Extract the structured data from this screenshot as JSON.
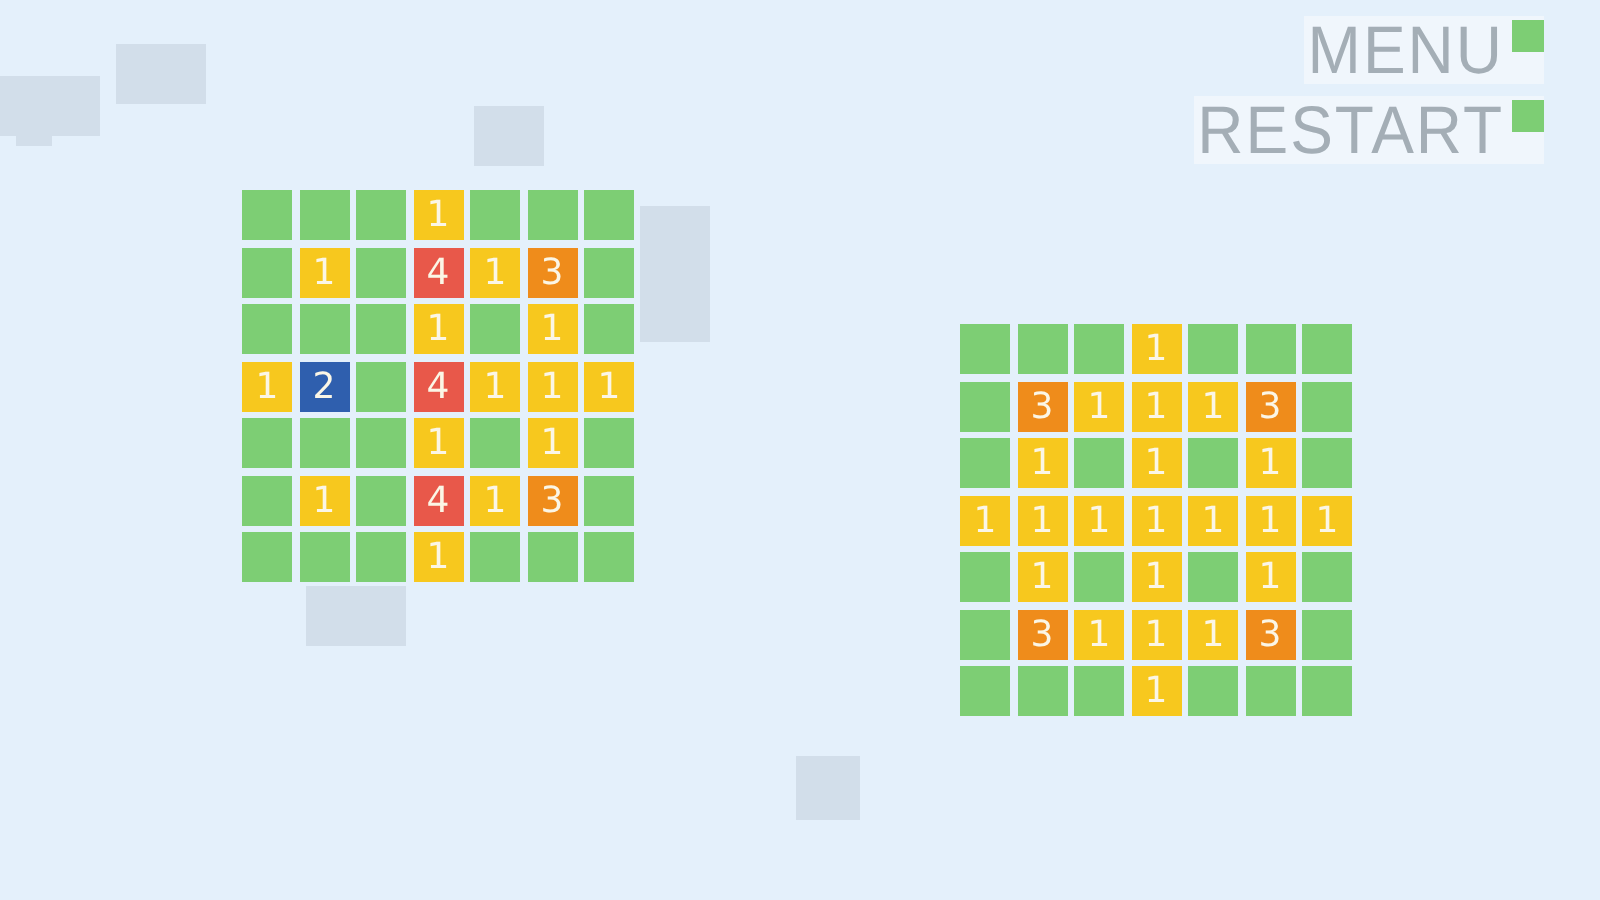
{
  "menu": [
    {
      "label": "MENU"
    },
    {
      "label": "RESTART"
    }
  ],
  "boards": [
    {
      "rows": [
        [
          {
            "color": "#7dce74"
          },
          {
            "color": "#7dce74"
          },
          {
            "color": "#7dce74"
          },
          {
            "n": "1",
            "color": "#f7c81e"
          },
          {
            "color": "#7dce74"
          },
          {
            "color": "#7dce74"
          },
          {
            "color": "#7dce74"
          }
        ],
        [
          {
            "color": "#7dce74"
          },
          {
            "n": "1",
            "color": "#f7c81e"
          },
          {
            "color": "#7dce74"
          },
          {
            "n": "4",
            "color": "#e8584a"
          },
          {
            "n": "1",
            "color": "#f7c81e"
          },
          {
            "n": "3",
            "color": "#ef8c1b"
          },
          {
            "color": "#7dce74"
          }
        ],
        [
          {
            "color": "#7dce74"
          },
          {
            "color": "#7dce74"
          },
          {
            "color": "#7dce74"
          },
          {
            "n": "1",
            "color": "#f7c81e"
          },
          {
            "color": "#7dce74"
          },
          {
            "n": "1",
            "color": "#f7c81e"
          },
          {
            "color": "#7dce74"
          }
        ],
        [
          {
            "n": "1",
            "color": "#f7c81e"
          },
          {
            "n": "2",
            "color": "#2f5fae"
          },
          {
            "color": "#7dce74"
          },
          {
            "n": "4",
            "color": "#e8584a"
          },
          {
            "n": "1",
            "color": "#f7c81e"
          },
          {
            "n": "1",
            "color": "#f7c81e"
          },
          {
            "n": "1",
            "color": "#f7c81e"
          }
        ],
        [
          {
            "color": "#7dce74"
          },
          {
            "color": "#7dce74"
          },
          {
            "color": "#7dce74"
          },
          {
            "n": "1",
            "color": "#f7c81e"
          },
          {
            "color": "#7dce74"
          },
          {
            "n": "1",
            "color": "#f7c81e"
          },
          {
            "color": "#7dce74"
          }
        ],
        [
          {
            "color": "#7dce74"
          },
          {
            "n": "1",
            "color": "#f7c81e"
          },
          {
            "color": "#7dce74"
          },
          {
            "n": "4",
            "color": "#e8584a"
          },
          {
            "n": "1",
            "color": "#f7c81e"
          },
          {
            "n": "3",
            "color": "#ef8c1b"
          },
          {
            "color": "#7dce74"
          }
        ],
        [
          {
            "color": "#7dce74"
          },
          {
            "color": "#7dce74"
          },
          {
            "color": "#7dce74"
          },
          {
            "n": "1",
            "color": "#f7c81e"
          },
          {
            "color": "#7dce74"
          },
          {
            "color": "#7dce74"
          },
          {
            "color": "#7dce74"
          }
        ]
      ]
    },
    {
      "rows": [
        [
          {
            "color": "#7dce74"
          },
          {
            "color": "#7dce74"
          },
          {
            "color": "#7dce74"
          },
          {
            "n": "1",
            "color": "#f7c81e"
          },
          {
            "color": "#7dce74"
          },
          {
            "color": "#7dce74"
          },
          {
            "color": "#7dce74"
          }
        ],
        [
          {
            "color": "#7dce74"
          },
          {
            "n": "3",
            "color": "#ef8c1b"
          },
          {
            "n": "1",
            "color": "#f7c81e"
          },
          {
            "n": "1",
            "color": "#f7c81e"
          },
          {
            "n": "1",
            "color": "#f7c81e"
          },
          {
            "n": "3",
            "color": "#ef8c1b"
          },
          {
            "color": "#7dce74"
          }
        ],
        [
          {
            "color": "#7dce74"
          },
          {
            "n": "1",
            "color": "#f7c81e"
          },
          {
            "color": "#7dce74"
          },
          {
            "n": "1",
            "color": "#f7c81e"
          },
          {
            "color": "#7dce74"
          },
          {
            "n": "1",
            "color": "#f7c81e"
          },
          {
            "color": "#7dce74"
          }
        ],
        [
          {
            "n": "1",
            "color": "#f7c81e"
          },
          {
            "n": "1",
            "color": "#f7c81e"
          },
          {
            "n": "1",
            "color": "#f7c81e"
          },
          {
            "n": "1",
            "color": "#f7c81e"
          },
          {
            "n": "1",
            "color": "#f7c81e"
          },
          {
            "n": "1",
            "color": "#f7c81e"
          },
          {
            "n": "1",
            "color": "#f7c81e"
          }
        ],
        [
          {
            "color": "#7dce74"
          },
          {
            "n": "1",
            "color": "#f7c81e"
          },
          {
            "color": "#7dce74"
          },
          {
            "n": "1",
            "color": "#f7c81e"
          },
          {
            "color": "#7dce74"
          },
          {
            "n": "1",
            "color": "#f7c81e"
          },
          {
            "color": "#7dce74"
          }
        ],
        [
          {
            "color": "#7dce74"
          },
          {
            "n": "3",
            "color": "#ef8c1b"
          },
          {
            "n": "1",
            "color": "#f7c81e"
          },
          {
            "n": "1",
            "color": "#f7c81e"
          },
          {
            "n": "1",
            "color": "#f7c81e"
          },
          {
            "n": "3",
            "color": "#ef8c1b"
          },
          {
            "color": "#7dce74"
          }
        ],
        [
          {
            "color": "#7dce74"
          },
          {
            "color": "#7dce74"
          },
          {
            "color": "#7dce74"
          },
          {
            "n": "1",
            "color": "#f7c81e"
          },
          {
            "color": "#7dce74"
          },
          {
            "color": "#7dce74"
          },
          {
            "color": "#7dce74"
          }
        ]
      ]
    }
  ]
}
